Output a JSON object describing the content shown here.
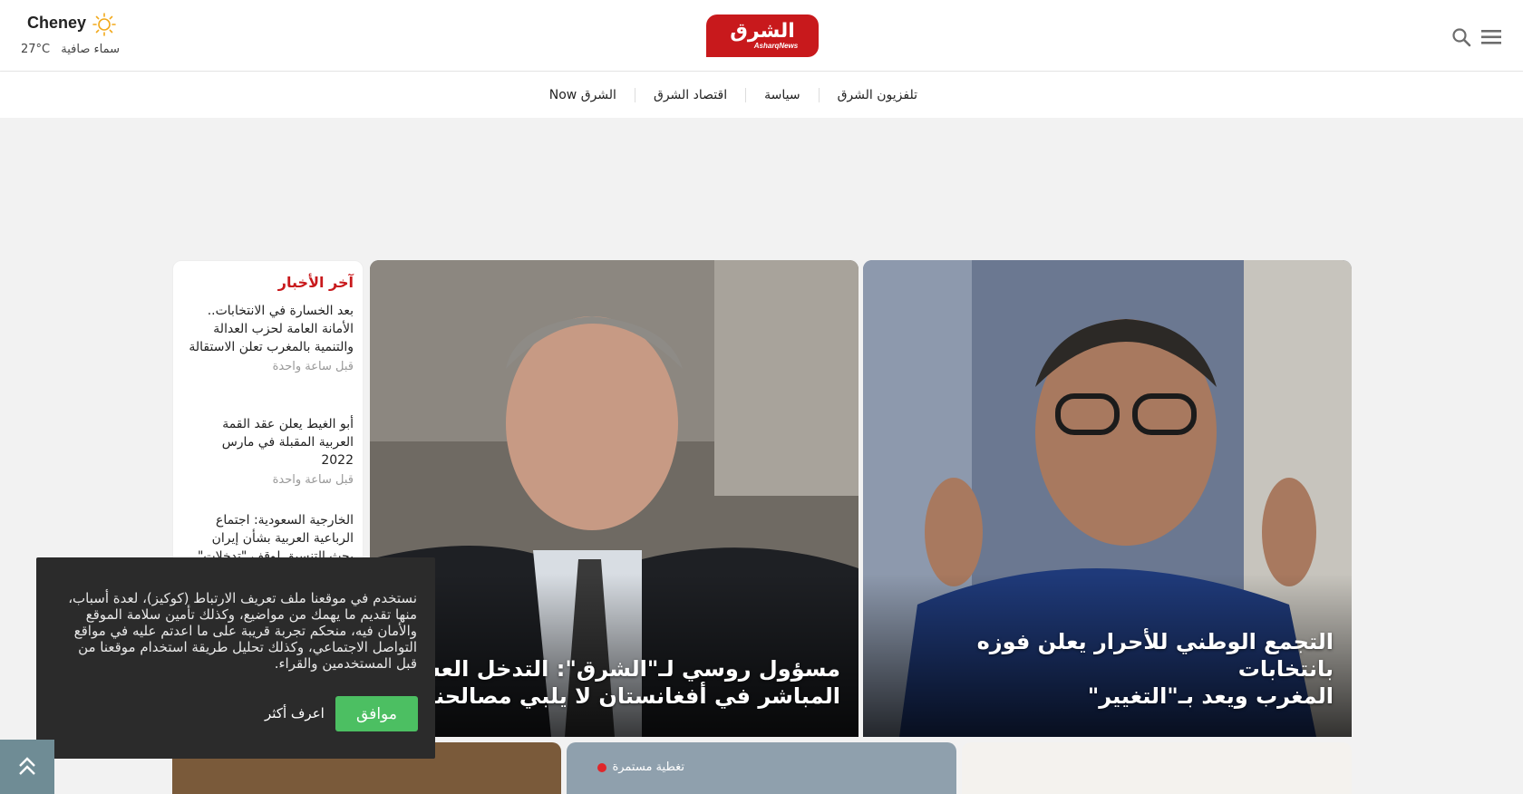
{
  "weather": {
    "city": "Cheney",
    "condition": "سماء صافية",
    "temp": "27°C",
    "icon": "sun-icon"
  },
  "logo": {
    "arabic": "الشرق",
    "english": "AsharqNews",
    "color": "#c8191c"
  },
  "header_icons": [
    "search-icon",
    "menu-icon"
  ],
  "nav": {
    "items": [
      {
        "label": "تلفزيون الشرق"
      },
      {
        "label": "سياسة"
      },
      {
        "label": "اقتصاد الشرق"
      },
      {
        "label": "الشرق Now"
      }
    ]
  },
  "latest": {
    "title": "آخر الأخبار",
    "items": [
      {
        "text": "بعد الخسارة في الانتخابات.. الأمانة العامة لحزب العدالة والتنمية بالمغرب تعلن الاستقالة",
        "time": "قبل ساعة واحدة"
      },
      {
        "text": "أبو الغيط يعلن عقد القمة العربية المقبلة في مارس 2022",
        "time": "قبل ساعة واحدة"
      },
      {
        "text": "الخارجية السعودية: اجتماع الرباعية العربية بشأن إيران بحث التنسيق لوقف \"تدخلات\" طهران",
        "time": ""
      }
    ]
  },
  "cards": {
    "main_right": {
      "title": "التجمع الوطني للأحرار يعلن فوزه بانتخابات\nالمغرب ويعد بـ\"التغيير\""
    },
    "main_left": {
      "title": "مسؤول روسي لـ\"الشرق\": التدخل العسكري\nالمباشر في أفغانستان لا يلبي مصالحنا"
    },
    "live_badge": "تغطية مستمرة"
  },
  "cookie": {
    "text": "نستخدم في موقعنا ملف تعريف الارتباط (كوكيز)، لعدة أسباب، منها تقديم ما يهمك من مواضيع، وكذلك تأمين سلامة الموقع والأمان فيه، منحكم تجربة قريبة على ما اعدتم عليه في مواقع التواصل الاجتماعي، وكذلك تحليل طريقة استخدام موقعنا من قبل المستخدمين والقراء.",
    "agree": "موافق",
    "more": "اعرف أكثر",
    "agree_color": "#4cbf62"
  },
  "scroll_top_icon": "chevron-up-icon"
}
